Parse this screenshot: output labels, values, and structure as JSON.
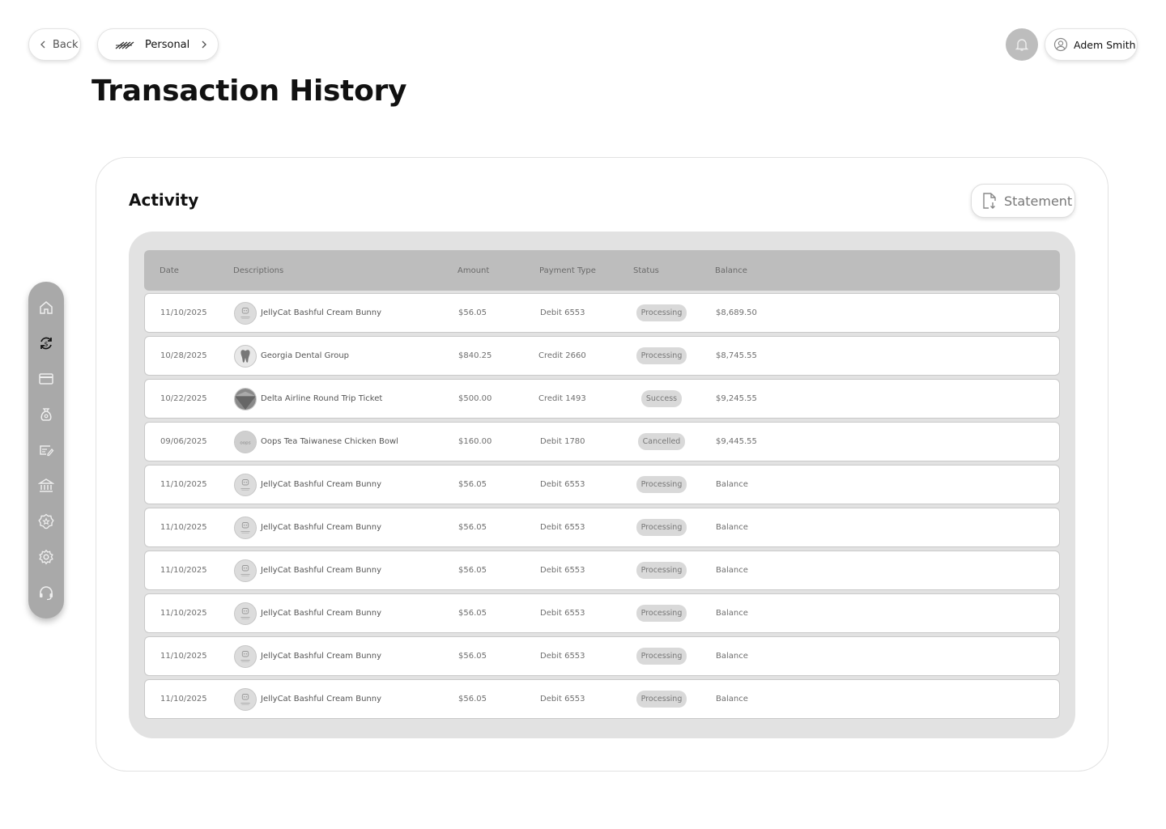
{
  "nav": {
    "back_label": "Back",
    "account_label": "Personal",
    "user_name": "Adem Smith"
  },
  "page": {
    "title": "Transaction History"
  },
  "activity": {
    "title": "Activity",
    "statement_label": "Statement",
    "columns": {
      "date": "Date",
      "description": "Descriptions",
      "amount": "Amount",
      "payment_type": "Payment Type",
      "status": "Status",
      "balance": "Balance"
    },
    "rows": [
      {
        "date": "11/10/2025",
        "description": "JellyCat Bashful Cream Bunny",
        "logo": "jellycat-logo",
        "amount": "$56.05",
        "payment_type": "Debit 6553",
        "status": "Processing",
        "balance": "$8,689.50"
      },
      {
        "date": "10/28/2025",
        "description": "Georgia Dental Group",
        "logo": "tooth-logo",
        "amount": "$840.25",
        "payment_type": "Credit 2660",
        "status": "Processing",
        "balance": "$8,745.55"
      },
      {
        "date": "10/22/2025",
        "description": "Delta Airline Round Trip Ticket",
        "logo": "delta-logo",
        "amount": "$500.00",
        "payment_type": "Credit 1493",
        "status": "Success",
        "balance": "$9,245.55"
      },
      {
        "date": "09/06/2025",
        "description": "Oops Tea Taiwanese Chicken Bowl",
        "logo": "oops-logo",
        "amount": "$160.00",
        "payment_type": "Debit 1780",
        "status": "Cancelled",
        "balance": "$9,445.55"
      },
      {
        "date": "11/10/2025",
        "description": "JellyCat Bashful Cream Bunny",
        "logo": "jellycat-logo",
        "amount": "$56.05",
        "payment_type": "Debit 6553",
        "status": "Processing",
        "balance": "Balance"
      },
      {
        "date": "11/10/2025",
        "description": "JellyCat Bashful Cream Bunny",
        "logo": "jellycat-logo",
        "amount": "$56.05",
        "payment_type": "Debit 6553",
        "status": "Processing",
        "balance": "Balance"
      },
      {
        "date": "11/10/2025",
        "description": "JellyCat Bashful Cream Bunny",
        "logo": "jellycat-logo",
        "amount": "$56.05",
        "payment_type": "Debit 6553",
        "status": "Processing",
        "balance": "Balance"
      },
      {
        "date": "11/10/2025",
        "description": "JellyCat Bashful Cream Bunny",
        "logo": "jellycat-logo",
        "amount": "$56.05",
        "payment_type": "Debit 6553",
        "status": "Processing",
        "balance": "Balance"
      },
      {
        "date": "11/10/2025",
        "description": "JellyCat Bashful Cream Bunny",
        "logo": "jellycat-logo",
        "amount": "$56.05",
        "payment_type": "Debit 6553",
        "status": "Processing",
        "balance": "Balance"
      },
      {
        "date": "11/10/2025",
        "description": "JellyCat Bashful Cream Bunny",
        "logo": "jellycat-logo",
        "amount": "$56.05",
        "payment_type": "Debit 6553",
        "status": "Processing",
        "balance": "Balance"
      }
    ]
  },
  "sidebar": {
    "items": [
      {
        "icon": "home-icon"
      },
      {
        "icon": "exchange-icon",
        "active": true
      },
      {
        "icon": "card-icon"
      },
      {
        "icon": "money-bag-icon"
      },
      {
        "icon": "check-edit-icon"
      },
      {
        "icon": "bank-icon"
      },
      {
        "icon": "badge-star-icon"
      },
      {
        "icon": "gear-icon"
      },
      {
        "icon": "support-icon"
      }
    ]
  },
  "colors": {
    "sidebar_bg": "#a9a9a9",
    "header_bg": "#bdbdbd",
    "panel_bg": "#e2e2e2",
    "badge_bg": "#d9d9d9"
  }
}
